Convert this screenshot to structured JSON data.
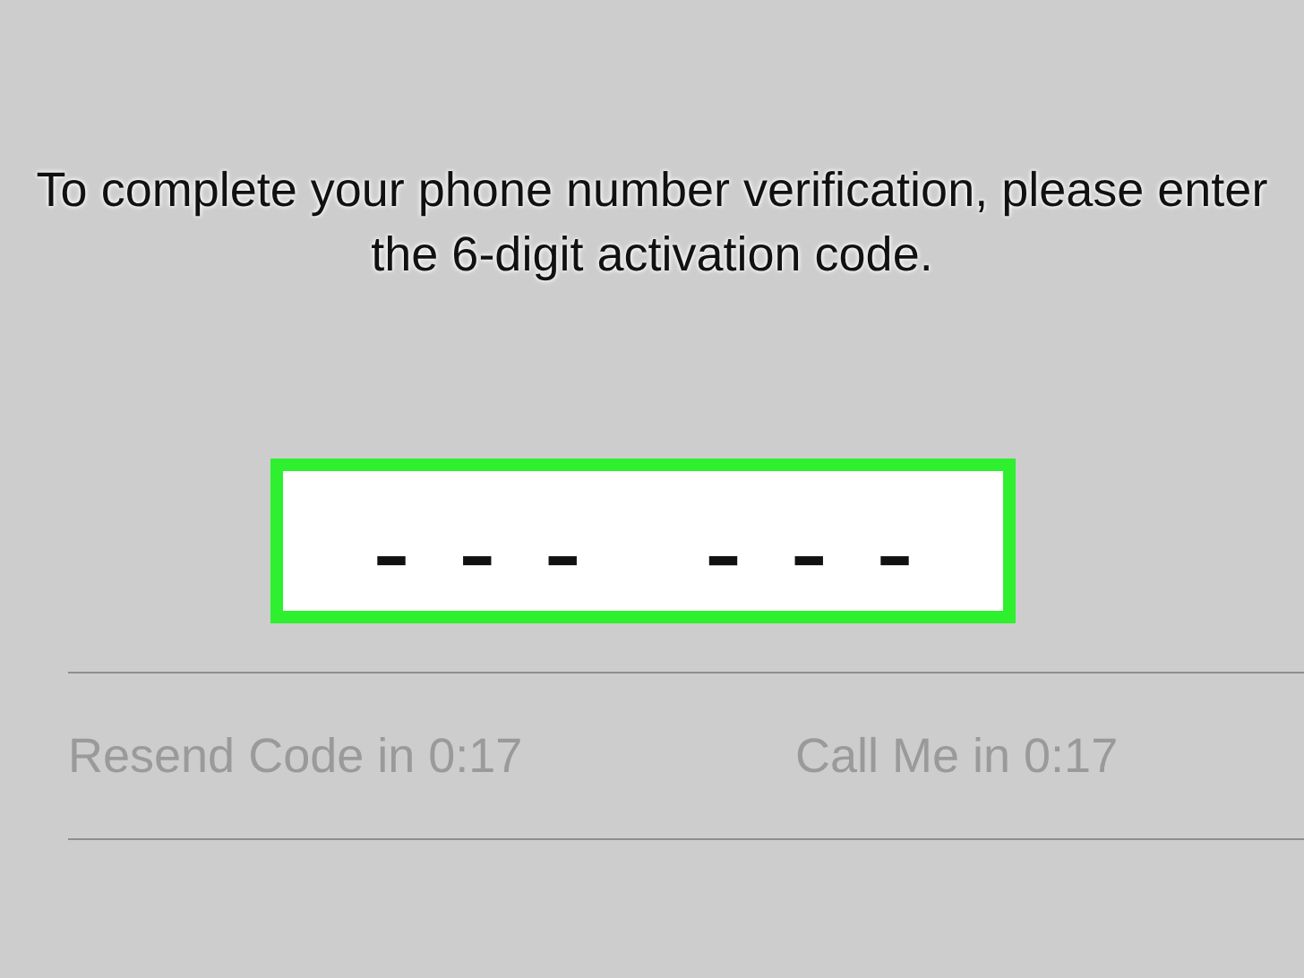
{
  "instructions": "To complete your phone number verification, please enter the 6-digit activation code.",
  "code_field": {
    "placeholder": "–  –  –     –  –  –"
  },
  "actions": [
    {
      "label": "Resend Code in 0:17",
      "disabled": true
    },
    {
      "label": "Call Me in 0:17",
      "disabled": true
    }
  ]
}
